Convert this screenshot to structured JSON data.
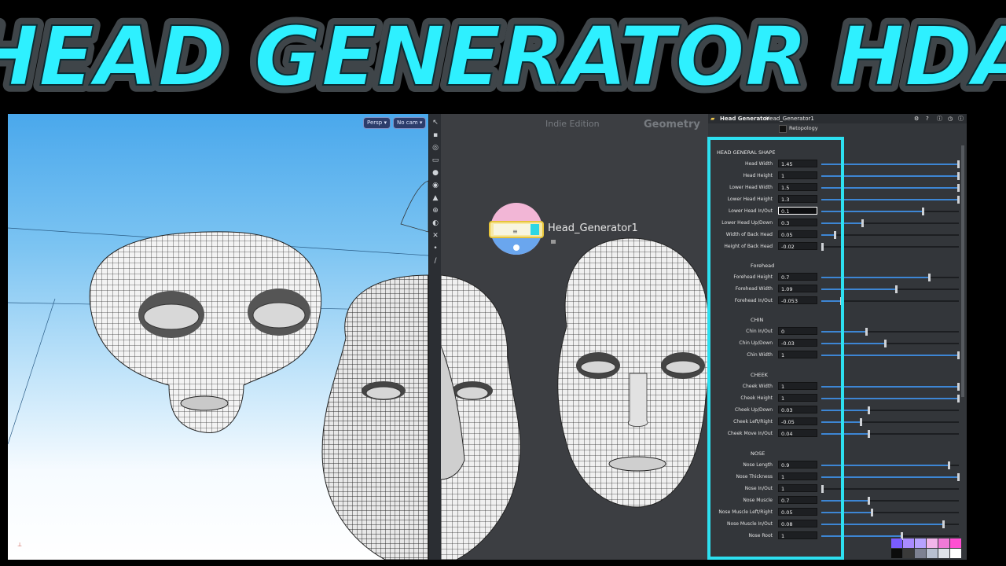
{
  "banner": {
    "title": "HEAD GENERATOR HDA"
  },
  "viewport": {
    "persp_label": "Persp",
    "cam_label": "No cam",
    "toolbar_icons": [
      "select-icon",
      "lock-icon",
      "eye-icon",
      "snap-icon",
      "light-icon",
      "camera-icon",
      "pin-icon",
      "zoom-icon",
      "frame-icon",
      "grid-icon",
      "dot-icon",
      "wrench-icon"
    ]
  },
  "network": {
    "edition_label": "Indie Edition",
    "context_label": "Geometry",
    "node_name": "Head_Generator1"
  },
  "panel": {
    "node_type": "Head Generator",
    "node_name": "Head_Generator1",
    "retopology_label": "Retopology",
    "sections": [
      {
        "title": "HEAD GENERAL SHAPE",
        "params": [
          {
            "label": "Head Width",
            "value": "1.45",
            "fill": 1.0
          },
          {
            "label": "Head Height",
            "value": "1",
            "fill": 1.0
          },
          {
            "label": "Lower Head Width",
            "value": "1.5",
            "fill": 1.0
          },
          {
            "label": "Lower Head Height",
            "value": "1.3",
            "fill": 1.0
          },
          {
            "label": "Lower Head In/Out",
            "value": "0.1",
            "fill": 0.74,
            "active": true
          },
          {
            "label": "Lower Head Up/Down",
            "value": "0.3",
            "fill": 0.3
          },
          {
            "label": "Width of Back Head",
            "value": "0.05",
            "fill": 0.1
          },
          {
            "label": "Height of Back Head",
            "value": "-0.02",
            "fill": 0.0
          }
        ]
      },
      {
        "title": "Forehead",
        "params": [
          {
            "label": "Forehead Height",
            "value": "0.7",
            "fill": 0.79
          },
          {
            "label": "Forehead Width",
            "value": "1.09",
            "fill": 0.55
          },
          {
            "label": "Forehead In/Out",
            "value": "-0.053",
            "fill": 0.15
          }
        ]
      },
      {
        "title": "CHIN",
        "params": [
          {
            "label": "Chin In/Out",
            "value": "0",
            "fill": 0.33
          },
          {
            "label": "Chin Up/Down",
            "value": "-0.03",
            "fill": 0.47
          },
          {
            "label": "Chin Width",
            "value": "1",
            "fill": 1.0
          }
        ]
      },
      {
        "title": "CHEEK",
        "params": [
          {
            "label": "Cheek Width",
            "value": "1",
            "fill": 1.0
          },
          {
            "label": "Cheek Height",
            "value": "1",
            "fill": 1.0
          },
          {
            "label": "Cheek Up/Down",
            "value": "0.03",
            "fill": 0.35
          },
          {
            "label": "Cheek Left/Right",
            "value": "-0.05",
            "fill": 0.29
          },
          {
            "label": "Cheek Move In/Out",
            "value": "0.04",
            "fill": 0.35
          }
        ]
      },
      {
        "title": "NOSE",
        "params": [
          {
            "label": "Nose Length",
            "value": "0.9",
            "fill": 0.93
          },
          {
            "label": "Nose Thickness",
            "value": "1",
            "fill": 1.0
          },
          {
            "label": "Nose In/Out",
            "value": "1",
            "fill": 0.0
          },
          {
            "label": "Nose Muscle",
            "value": "0.7",
            "fill": 0.35
          },
          {
            "label": "Nose Muscle Left/Right",
            "value": "0.05",
            "fill": 0.37
          },
          {
            "label": "Nose Muscle In/Out",
            "value": "0.08",
            "fill": 0.89
          },
          {
            "label": "Nose Root",
            "value": "1",
            "fill": 0.59
          }
        ]
      }
    ],
    "swatch_colors": [
      "#7a5cff",
      "#a98bff",
      "#b7a2ff",
      "#f2b6ea",
      "#f07ad7",
      "#ff4fd2",
      "#0c0c0c",
      "#3a3a3a",
      "#7d8191",
      "#b8c0d0",
      "#dfe3ea",
      "#ffffff"
    ]
  }
}
